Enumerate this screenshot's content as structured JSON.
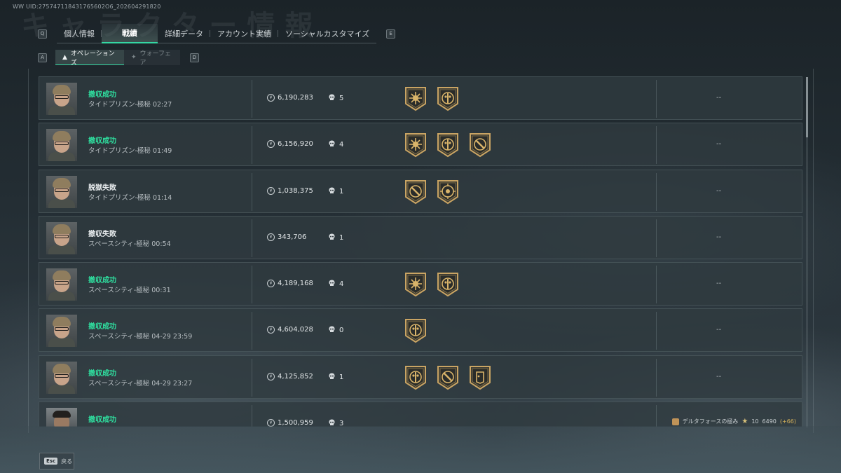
{
  "uid_text": "WW UID:275747118431765602O6_202604291820",
  "bg_title": "キャラクター情報",
  "top_tabs": {
    "left_key": "Q",
    "right_key": "E",
    "items": [
      {
        "label": "個人情報"
      },
      {
        "label": "戦績"
      },
      {
        "label": "詳細データ"
      },
      {
        "label": "アカウント実績"
      },
      {
        "label": "ソーシャルカスタマイズ"
      }
    ]
  },
  "sub_tabs": {
    "left_key": "A",
    "right_key": "D",
    "items": [
      {
        "label": "オペレーションズ"
      },
      {
        "label": "ウォーフェア"
      }
    ]
  },
  "rows": [
    {
      "status": "撤収成功",
      "map": "タイドプリズン-極秘 02:27",
      "value": "6,190,283",
      "kills": "5",
      "extra": "--"
    },
    {
      "status": "撤収成功",
      "map": "タイドプリズン-極秘 01:49",
      "value": "6,156,920",
      "kills": "4",
      "extra": "--"
    },
    {
      "status": "脱獄失敗",
      "map": "タイドプリズン-極秘 01:14",
      "value": "1,038,375",
      "kills": "1",
      "extra": "--"
    },
    {
      "status": "撤収失敗",
      "map": "スペースシティ-極秘 00:54",
      "value": "343,706",
      "kills": "1",
      "extra": "--"
    },
    {
      "status": "撤収成功",
      "map": "スペースシティ-極秘 00:31",
      "value": "4,189,168",
      "kills": "4",
      "extra": "--"
    },
    {
      "status": "撤収成功",
      "map": "スペースシティ-極秘 04-29 23:59",
      "value": "4,604,028",
      "kills": "0",
      "extra": "--"
    },
    {
      "status": "撤収成功",
      "map": "スペースシティ-極秘 04-29 23:27",
      "value": "4,125,852",
      "kills": "1",
      "extra": "--"
    },
    {
      "status": "撤収成功",
      "map": "",
      "value": "1,500,959",
      "kills": "3",
      "extra": "",
      "achievement": {
        "name": "デルタフォースの極み",
        "level": "10",
        "points": "6490",
        "bonus": "(+66)"
      }
    }
  ],
  "back": {
    "key": "Esc",
    "label": "戻る"
  },
  "colors": {
    "accent": "#34d7a3",
    "success": "#2fe0a0",
    "badge_gold": "#c9a463"
  },
  "icons": {
    "coin": "coin-icon",
    "kills": "skull-icon",
    "medal": "medal-badge-icon"
  }
}
